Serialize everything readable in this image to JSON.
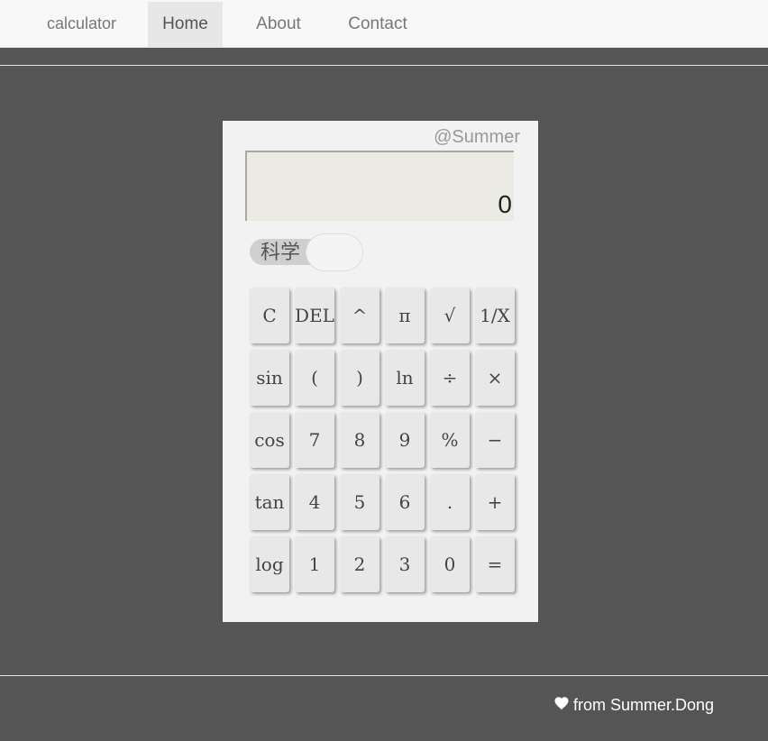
{
  "navbar": {
    "brand": "calculator",
    "links": [
      {
        "label": "Home",
        "active": true
      },
      {
        "label": "About",
        "active": false
      },
      {
        "label": "Contact",
        "active": false
      }
    ]
  },
  "calculator": {
    "signature": "@Summer",
    "display_value": "0",
    "mode_toggle": {
      "label": "科学",
      "on": false
    },
    "keys": [
      [
        "C",
        "DEL",
        "^",
        "π",
        "√",
        "1/X"
      ],
      [
        "sin",
        "(",
        ")",
        "ln",
        "÷",
        "×"
      ],
      [
        "cos",
        "7",
        "8",
        "9",
        "%",
        "−"
      ],
      [
        "tan",
        "4",
        "5",
        "6",
        ".",
        "+"
      ],
      [
        "log",
        "1",
        "2",
        "3",
        "0",
        "="
      ]
    ]
  },
  "footer": {
    "credit": "from Summer.Dong",
    "icon": "heart-icon"
  },
  "colors": {
    "page_background": "#555555",
    "navbar_background": "#f8f8f8",
    "calculator_background": "#f2f2f2",
    "display_background": "#ebebe4",
    "key_background": "#e8e8e8"
  }
}
